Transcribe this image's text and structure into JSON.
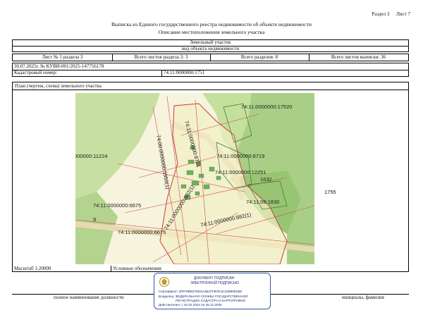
{
  "header": {
    "section": "Раздел 3",
    "sheet": "Лист 7",
    "title": "Выписка из Единого государственного реестра недвижимости об объекте недвижимости",
    "subtitle": "Описание местоположения земельного участка"
  },
  "object": {
    "type": "Земельный участок",
    "kind": "вид объекта недвижимости"
  },
  "sheet_row": {
    "sheet_no": "Лист № 1 раздела 3",
    "total_section": "Всего листов раздела 3: 3",
    "total_sections": "Всего разделов: 8",
    "total_sheets": "Всего листов выписки: 36"
  },
  "doc": {
    "date_no": "30.07.2025г. № КУВИ-001/2025-147756178",
    "cadastral_label": "Кадастровый номер:",
    "cadastral_value": "74:11:0000000:1751"
  },
  "plan": {
    "title": "План (чертеж, схема) земельного участка"
  },
  "map_labels": {
    "l1": "74:11:0000000:17520",
    "l2": "000000:11224",
    "l3": "74:11:0000000:8719",
    "l4": "74:11:0000000:12251",
    "l5": "1632",
    "l6": "1755",
    "l7": "74:11:0000000:6675",
    "l8": "9",
    "l9": "74:11:0000000:6675",
    "l10": "74:11:0000000:882(1)",
    "l11": "74:00:0000000:5959(1)",
    "l12": "74:11:0000000:882(1)",
    "l13": "74:11:0000000:8721",
    "l14": "74:11:06:1830"
  },
  "footer": {
    "scale": "Масштаб 1:20000",
    "legend": "Условные обозначения:",
    "position": "полное наименование должности",
    "initials": "инициалы, фамилия"
  },
  "stamp": {
    "line1": "ДОКУМЕНТ ПОДПИСАН",
    "line2": "ЭЛЕКТРОННОЙ ПОДПИСЬЮ",
    "cert": "Сертификат: 00FF9BB27EE5A4B1FFB7E1E1D9B8E5B0",
    "owner": "Владелец: ФЕДЕРАЛЬНАЯ СЛУЖБА ГОСУДАРСТВЕННОЙ",
    "owner2": "РЕГИСТРАЦИИ, КАДАСТРА И КАРТОГРАФИИ",
    "valid": "Действителен: с 02.02.2024 по 28.12.2025",
    "border_color": "#3a56a6"
  }
}
